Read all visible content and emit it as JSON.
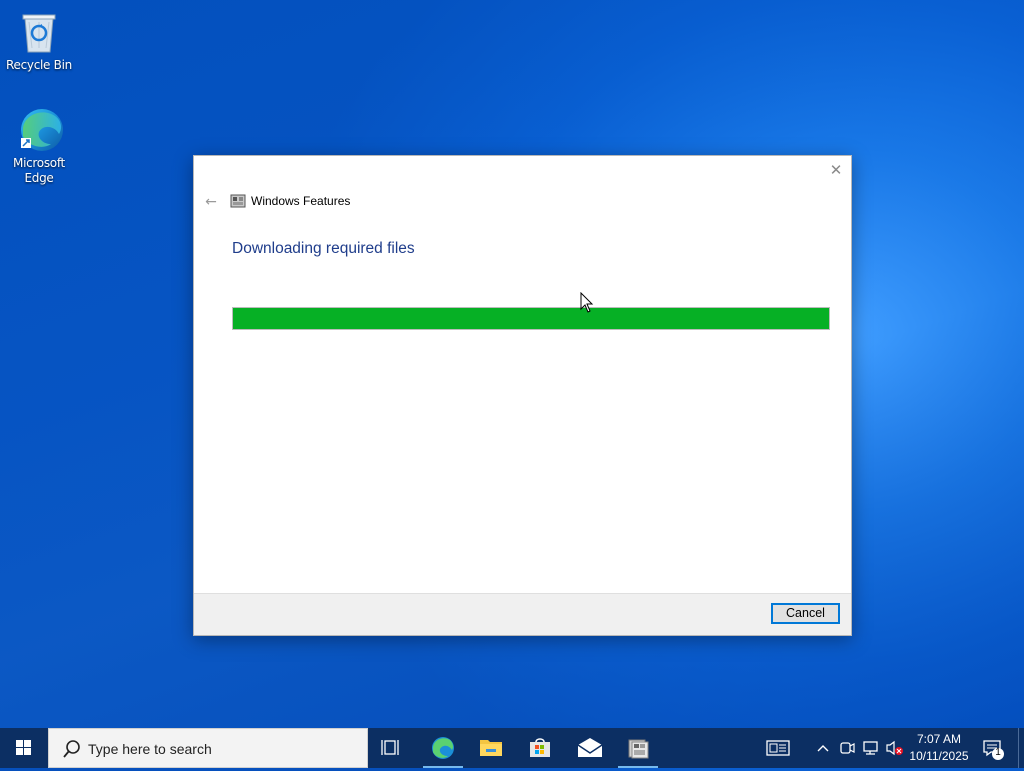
{
  "desktop": {
    "icons": [
      {
        "label": "Recycle Bin",
        "icon": "recycle-bin-icon"
      },
      {
        "label": "Microsoft Edge",
        "icon": "edge-icon"
      }
    ]
  },
  "dialog": {
    "title": "Windows Features",
    "heading": "Downloading required files",
    "progress_percent": 100,
    "progress_color": "#06b025",
    "cancel_label": "Cancel",
    "close_icon": "close-icon",
    "back_icon": "back-arrow-icon"
  },
  "taskbar": {
    "search_placeholder": "Type here to search",
    "apps": [
      "task-view-icon",
      "edge-icon",
      "file-explorer-icon",
      "store-icon",
      "mail-icon",
      "windows-features-icon"
    ],
    "tray_icons": [
      "news-icon",
      "chevron-up-icon",
      "meet-now-icon",
      "network-icon",
      "volume-muted-icon"
    ],
    "time": "7:07 AM",
    "date": "10/11/2025",
    "notification_count": "1"
  },
  "colors": {
    "taskbar_bg": "#0c2f63",
    "accent": "#0078d7",
    "heading": "#1f3d8b"
  }
}
